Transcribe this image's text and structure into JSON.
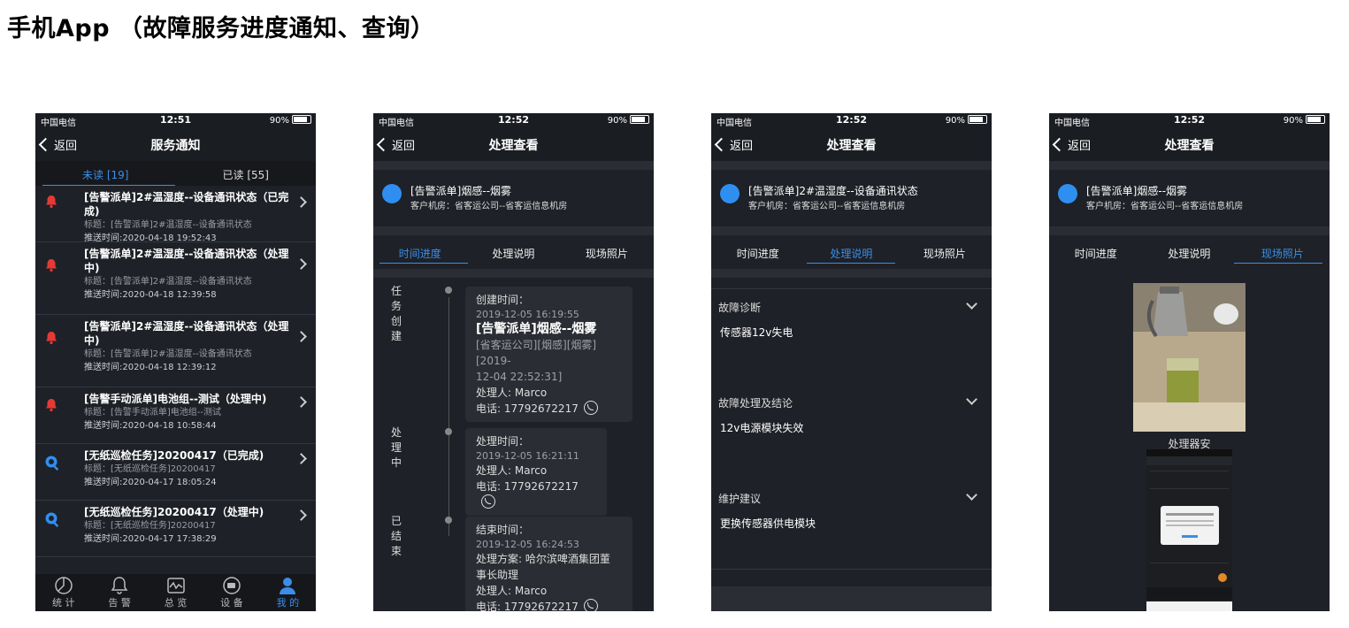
{
  "page": {
    "title": "手机App （故障服务进度通知、查询）"
  },
  "status": {
    "carrier": "中国电信",
    "battery": "90%"
  },
  "common": {
    "back": "返回"
  },
  "phone1": {
    "time": "12:51",
    "nav_title": "服务通知",
    "tabs": [
      "未读 [19]",
      "已读 [55]"
    ],
    "messages": [
      {
        "title": "[告警派单]2#温湿度--设备通讯状态（已完成)",
        "subject": "标题：[告警派单]2#温湿度--设备通讯状态",
        "push": "推送时间:2020-04-18 19:52:43",
        "icon": "alarm-bell-icon"
      },
      {
        "title": "[告警派单]2#温湿度--设备通讯状态（处理中)",
        "subject": "标题：[告警派单]2#温湿度--设备通讯状态",
        "push": "推送时间:2020-04-18 12:39:58",
        "icon": "alarm-bell-icon"
      },
      {
        "title": "[告警派单]2#温湿度--设备通讯状态（处理中)",
        "subject": "标题：[告警派单]2#温湿度--设备通讯状态",
        "push": "推送时间:2020-04-18 12:39:12",
        "icon": "alarm-bell-icon"
      },
      {
        "title": "[告警手动派单]电池组--测试（处理中)",
        "subject": "标题：[告警手动派单]电池组--测试",
        "push": "推送时间:2020-04-18 10:58:44",
        "icon": "alarm-bell-icon"
      },
      {
        "title": "[无纸巡检任务]20200417（已完成)",
        "subject": "标题：[无纸巡检任务]20200417",
        "push": "推送时间:2020-04-17 18:05:24",
        "icon": "inspection-icon"
      },
      {
        "title": "[无纸巡检任务]20200417（处理中)",
        "subject": "标题：[无纸巡检任务]20200417",
        "push": "推送时间:2020-04-17 17:38:29",
        "icon": "inspection-icon"
      }
    ],
    "tabbar": [
      "统 计",
      "告 警",
      "总 览",
      "设 备",
      "我 的"
    ]
  },
  "phone2": {
    "time": "12:52",
    "nav_title": "处理查看",
    "header_title": "[告警派单]烟感--烟雾",
    "header_sub": "客户机房：省客运公司--省客运信息机房",
    "tabs": [
      "时间进度",
      "处理说明",
      "现场照片"
    ],
    "steps": [
      {
        "label": "任务创建",
        "time_label": "创建时间：",
        "time": "2019-12-05 16:19:55",
        "headline": "[告警派单]烟感--烟雾",
        "detail1": "[省客运公司][烟感][烟雾][2019-",
        "detail2": "12-04 22:52:31]",
        "handler": "处理人: Marco",
        "phone": "电话: 17792672217"
      },
      {
        "label": "处理中",
        "time_label": "处理时间：",
        "time": "2019-12-05 16:21:11",
        "handler": "处理人: Marco",
        "phone": "电话: 17792672217"
      },
      {
        "label": "已结束",
        "time_label": "结束时间：",
        "time": "2019-12-05 16:24:53",
        "plan1": "处理方案: 哈尔滨啤酒集团董",
        "plan2": "事长助理",
        "handler": "处理人: Marco",
        "phone": "电话: 17792672217"
      }
    ]
  },
  "phone3": {
    "time": "12:52",
    "nav_title": "处理查看",
    "header_title": "[告警派单]2#温湿度--设备通讯状态",
    "header_sub": "客户机房：省客运公司--省客运信息机房",
    "tabs": [
      "时间进度",
      "处理说明",
      "现场照片"
    ],
    "sections": [
      {
        "title": "故障诊断",
        "value": "传感器12v失电"
      },
      {
        "title": "故障处理及结论",
        "value": "12v电源模块失效"
      },
      {
        "title": "维护建议",
        "value": "更换传感器供电模块"
      }
    ]
  },
  "phone4": {
    "time": "12:52",
    "nav_title": "处理查看",
    "header_title": "[告警派单]烟感--烟雾",
    "header_sub": "客户机房：省客运公司--省客运信息机房",
    "tabs": [
      "时间进度",
      "处理说明",
      "现场照片"
    ],
    "photo_caption": "处理器安"
  }
}
